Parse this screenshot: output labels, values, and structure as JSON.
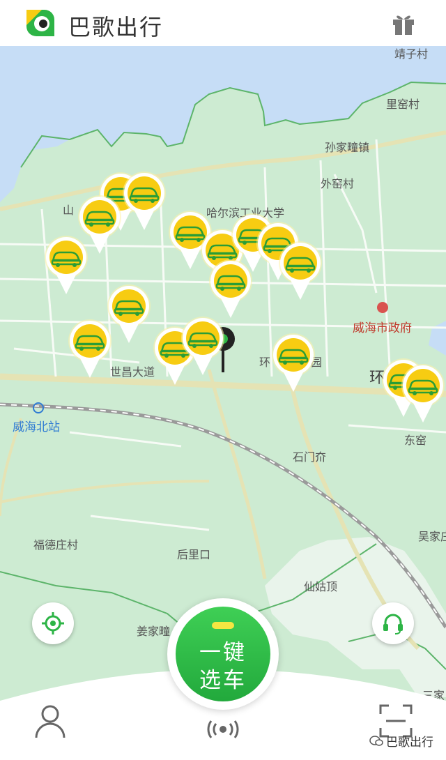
{
  "header": {
    "app_title": "巴歌出行"
  },
  "map": {
    "labels": {
      "jingzi": "靖子村",
      "liku": "里窑村",
      "sunjia": "孙家疃镇",
      "waiyao": "外窑村",
      "shan": "山",
      "hit": "哈尔滨工业大学",
      "gov": "威海市政府",
      "huan_park": "环",
      "huan_park2": "园",
      "huan_big": "环",
      "shichang": "世昌大道",
      "north_station": "威海北站",
      "dongyao": "东窑",
      "shimen": "石门夼",
      "fude": "福德庄村",
      "houlikou": "后里口",
      "wujia": "吴家庄",
      "xiangu": "仙姑顶",
      "jiangjia": "姜家疃",
      "sanjia": "三家"
    }
  },
  "actions": {
    "main_button_line1": "一键",
    "main_button_line2": "选车"
  },
  "watermark": {
    "text": "巴歌出行"
  },
  "colors": {
    "brand_green": "#2db446",
    "pin_yellow": "#f7cc12",
    "map_bg": "#cdebd2"
  }
}
